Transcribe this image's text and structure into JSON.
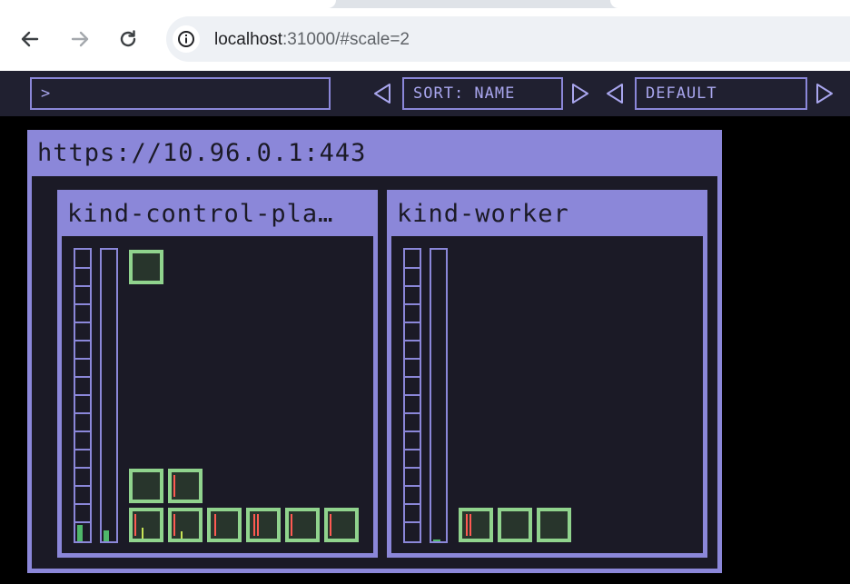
{
  "browser": {
    "url_host": "localhost",
    "url_path": ":31000/#scale=2",
    "icons": {
      "back": "arrow-left-icon",
      "forward": "arrow-right-icon",
      "reload": "reload-icon",
      "site_info": "info-icon"
    }
  },
  "toolbar": {
    "filter_value": ">",
    "sort_label": "SORT: NAME",
    "theme_label": "DEFAULT",
    "icons": {
      "prev": "triangle-left-icon",
      "next": "triangle-right-icon"
    }
  },
  "cluster": {
    "title": "https://10.96.0.1:443",
    "nodes": [
      {
        "name": "kind-control-pla…",
        "pod_count": 10
      },
      {
        "name": "kind-worker",
        "pod_count": 3
      }
    ]
  },
  "colors": {
    "accent": "#8b87d9",
    "panel_bg": "#1b1a26",
    "topbar_bg": "#202030",
    "pod_border": "#90d38d",
    "pod_fill": "#28352c",
    "status_red": "#ff5a52",
    "status_yellow": "#c7e356",
    "usage_green": "#4fb86a"
  }
}
